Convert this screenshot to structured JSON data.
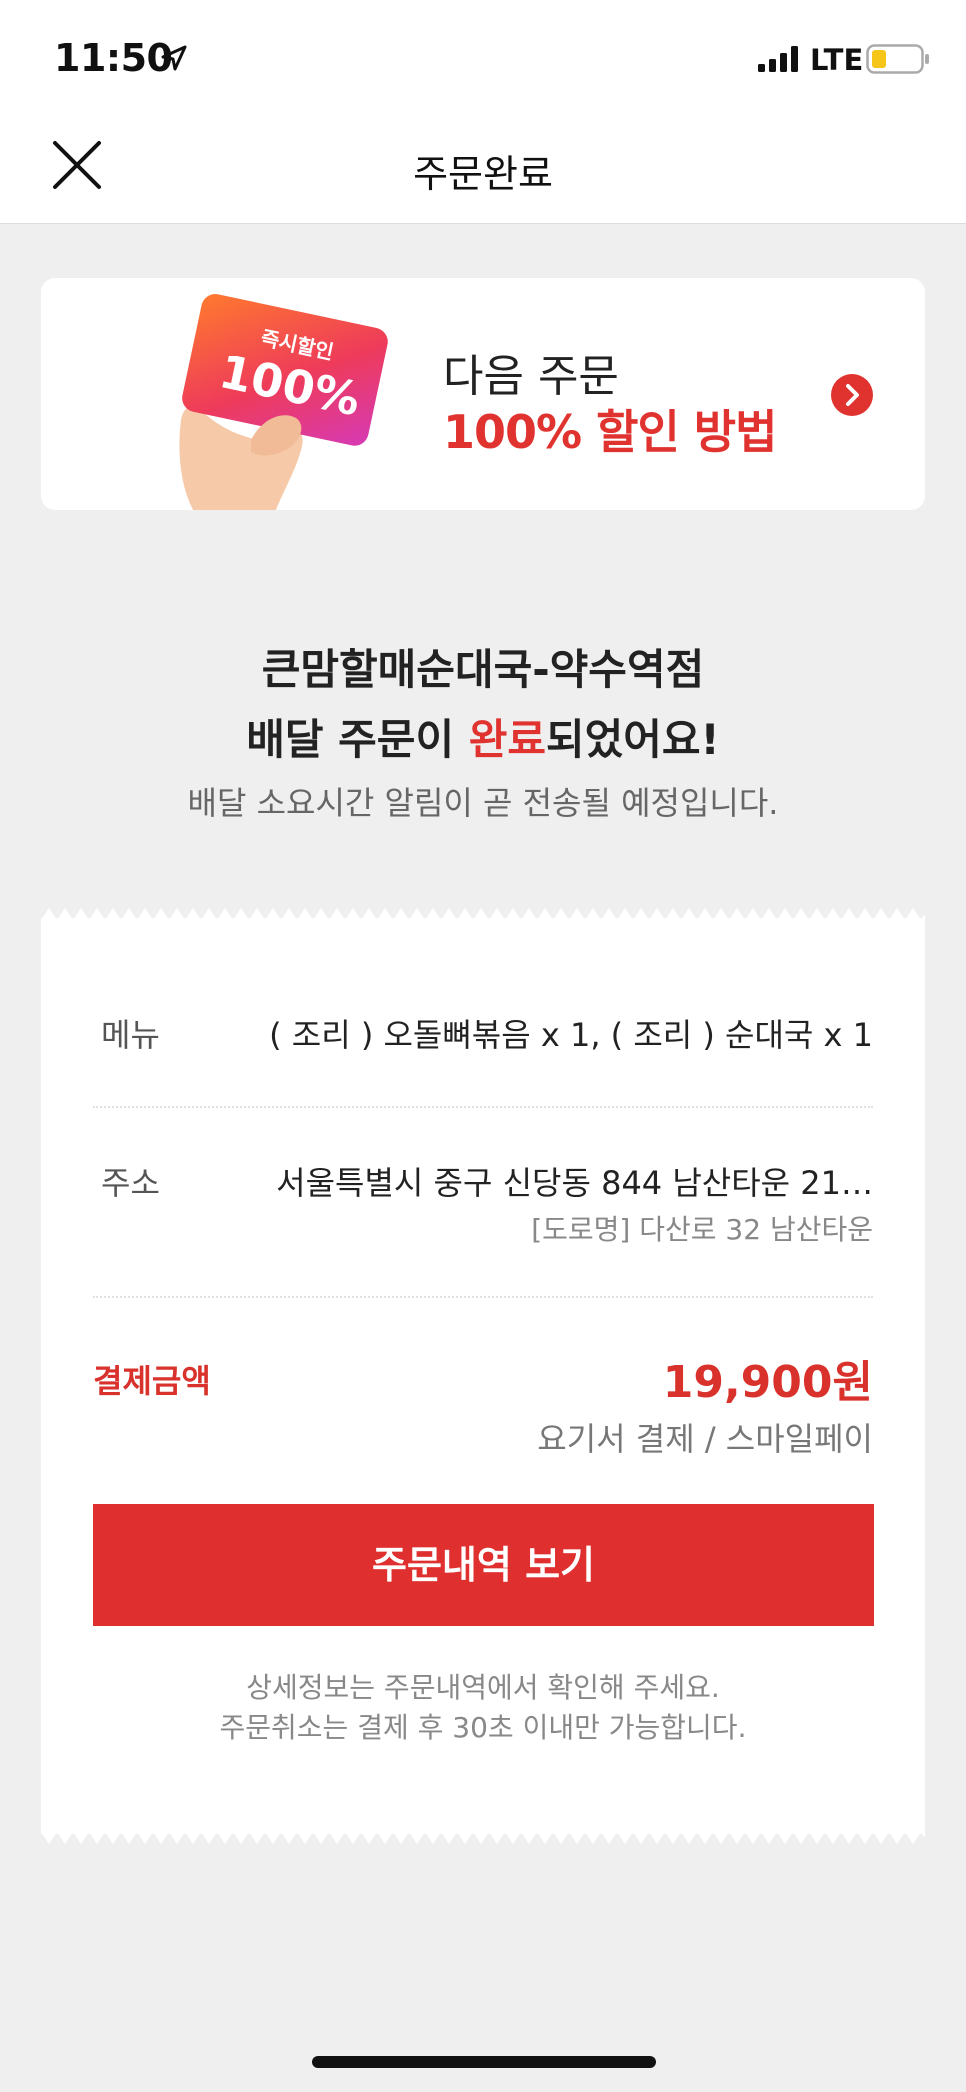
{
  "status_bar": {
    "time": "11:50",
    "network": "LTE",
    "icons": [
      "location-arrow-icon",
      "signal-bars-icon",
      "battery-icon"
    ]
  },
  "nav": {
    "title": "주문완료",
    "close_icon": "close-icon"
  },
  "promo": {
    "card_tag": "즉시할인",
    "card_percent": "100%",
    "line1": "다음 주문",
    "line2": "100% 할인 방법",
    "arrow_icon": "chevron-right-circle-icon",
    "accent_color": "#e0332f"
  },
  "completion": {
    "store_name": "큰맘할매순대국-약수역점",
    "message_prefix": "배달 주문이 ",
    "message_highlight": "완료",
    "message_suffix": "되었어요!",
    "notice": "배달 소요시간 알림이 곧 전송될 예정입니다."
  },
  "receipt": {
    "menu_label": "메뉴",
    "menu_value": "( 조리 ) 오돌뼈볶음 x 1, ( 조리 ) 순대국 x 1",
    "address_label": "주소",
    "address_value": "서울특별시 중구 신당동 844 남산타운 21…",
    "address_road": "[도로명] 다산로 32 남산타운",
    "payment_label": "결제금액",
    "payment_amount": "19,900원",
    "payment_method": "요기서 결제 / 스마일페이",
    "order_history_button": "주문내역 보기",
    "help_line1": "상세정보는 주문내역에서 확인해 주세요.",
    "help_line2": "주문취소는 결제 후 30초 이내만 가능합니다."
  },
  "colors": {
    "brand_red": "#e02f2f",
    "background": "#efefef"
  }
}
